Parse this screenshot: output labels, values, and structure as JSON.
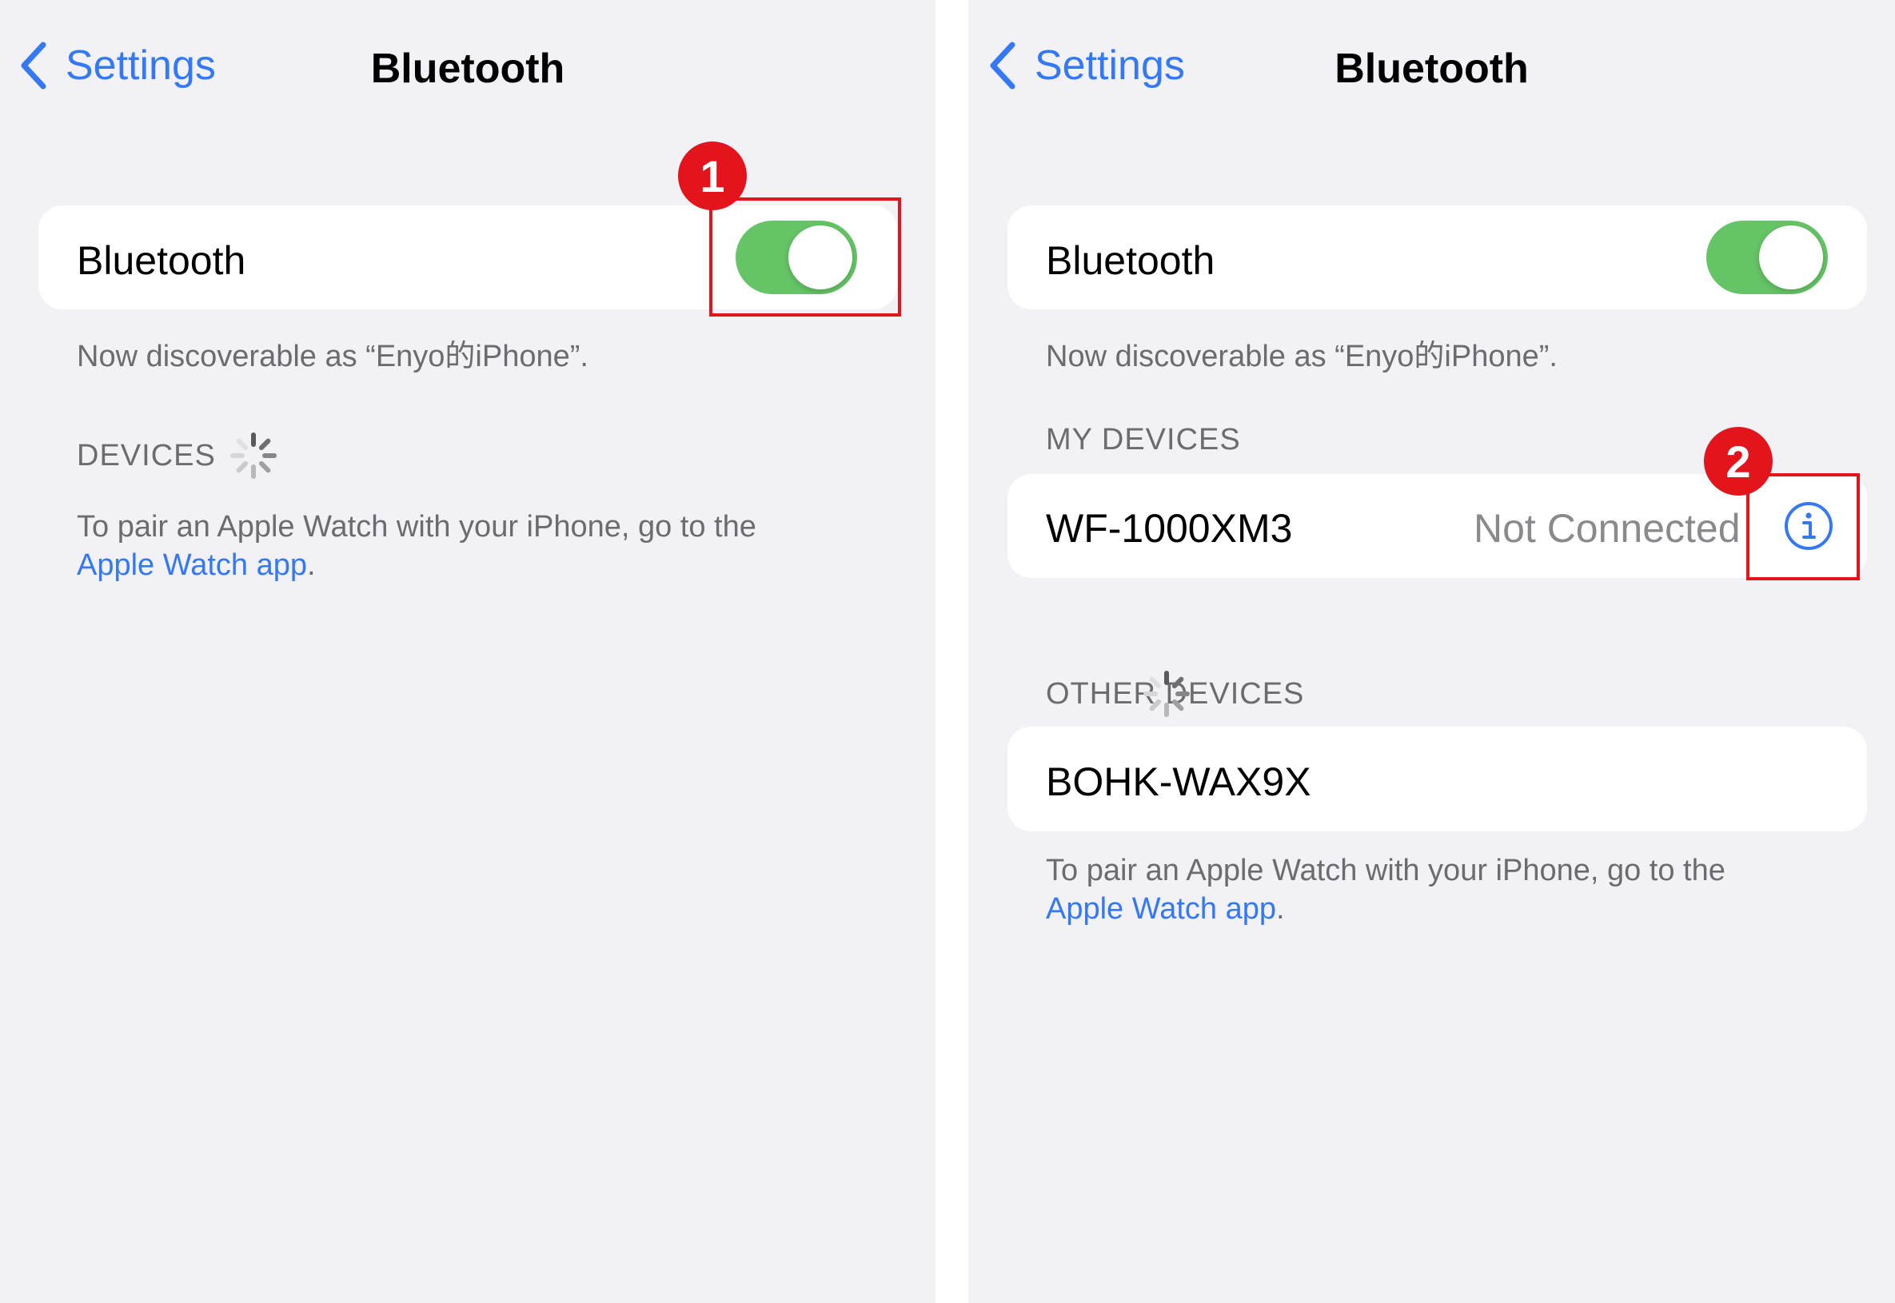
{
  "left": {
    "nav": {
      "back_label": "Settings",
      "title": "Bluetooth"
    },
    "bluetooth_row": {
      "label": "Bluetooth",
      "toggle_on": true
    },
    "discoverable_text": "Now discoverable as “Enyo的iPhone”.",
    "devices_header": "DEVICES",
    "pair_text_line1": "To pair an Apple Watch with your iPhone, go to the",
    "pair_link": "Apple Watch app",
    "pair_suffix": ".",
    "annotation_badge": "1"
  },
  "right": {
    "nav": {
      "back_label": "Settings",
      "title": "Bluetooth"
    },
    "bluetooth_row": {
      "label": "Bluetooth",
      "toggle_on": true
    },
    "discoverable_text": "Now discoverable as “Enyo的iPhone”.",
    "my_devices_header": "MY DEVICES",
    "my_devices": [
      {
        "name": "WF-1000XM3",
        "status": "Not Connected"
      }
    ],
    "other_devices_header": "OTHER DEVICES",
    "other_devices": [
      {
        "name": "BOHK-WAX9X"
      }
    ],
    "pair_text_line1": "To pair an Apple Watch with your iPhone, go to the",
    "pair_link": "Apple Watch app",
    "pair_suffix": ".",
    "annotation_badge": "2"
  },
  "colors": {
    "accent": "#3478f6",
    "toggle_on": "#65c466",
    "annotation_red": "#e3141c",
    "background": "#f1f1f6",
    "secondary_text": "#6c6c70"
  },
  "icons": {
    "back": "chevron-left-icon",
    "spinner": "activity-spinner-icon",
    "info": "info-circle-icon"
  }
}
